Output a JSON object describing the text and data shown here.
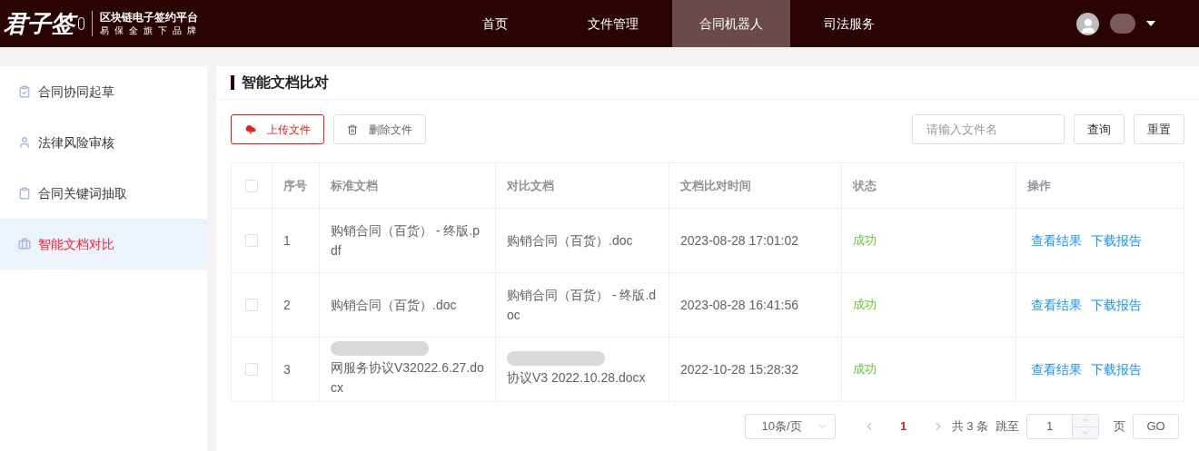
{
  "header": {
    "logo": {
      "mark": "君子签",
      "title": "区块链电子签约平台",
      "subtitle": "易保全旗下品牌"
    },
    "nav": [
      {
        "label": "首页",
        "selected": false
      },
      {
        "label": "文件管理",
        "selected": false
      },
      {
        "label": "合同机器人",
        "selected": true
      },
      {
        "label": "司法服务",
        "selected": false
      }
    ]
  },
  "sidebar": {
    "items": [
      {
        "label": "合同协同起草",
        "selected": false
      },
      {
        "label": "法律风险审核",
        "selected": false
      },
      {
        "label": "合同关键词抽取",
        "selected": false
      },
      {
        "label": "智能文档对比",
        "selected": true
      }
    ]
  },
  "page_title": "智能文档比对",
  "toolbar": {
    "upload": "上传文件",
    "delete": "删除文件",
    "search": {
      "placeholder": "请输入文件名"
    },
    "query": "查询",
    "reset": "重置"
  },
  "table": {
    "all_checked": false,
    "columns": [
      "序号",
      "标准文档",
      "对比文档",
      "文档比对时间",
      "状态",
      "操作"
    ],
    "rows": [
      {
        "checked": false,
        "index": "1",
        "standard": "购销合同（百货） - 终版.pdf",
        "standard_redacted": false,
        "compare": "购销合同（百货）.doc",
        "compare_redacted": false,
        "time": "2023-08-28 17:01:02",
        "status": "成功",
        "actions": [
          "查看结果",
          "下载报告"
        ]
      },
      {
        "checked": false,
        "index": "2",
        "standard": "购销合同（百货）.doc",
        "standard_redacted": false,
        "compare": "购销合同（百货） - 终版.doc",
        "compare_redacted": false,
        "time": "2023-08-28 16:41:56",
        "status": "成功",
        "actions": [
          "查看结果",
          "下载报告"
        ]
      },
      {
        "checked": false,
        "index": "3",
        "standard": "网服务协议V32022.6.27.docx",
        "standard_redacted": true,
        "compare": "协议V3 2022.10.28.docx",
        "compare_redacted": true,
        "time": "2022-10-28 15:28:32",
        "status": "成功",
        "actions": [
          "查看结果",
          "下载报告"
        ]
      }
    ]
  },
  "pagination": {
    "page_size": "10条/页",
    "current": "1",
    "total": "共 3 条",
    "jump_label": "跳至",
    "jump_value": "1",
    "page_unit": "页",
    "go": "GO"
  }
}
